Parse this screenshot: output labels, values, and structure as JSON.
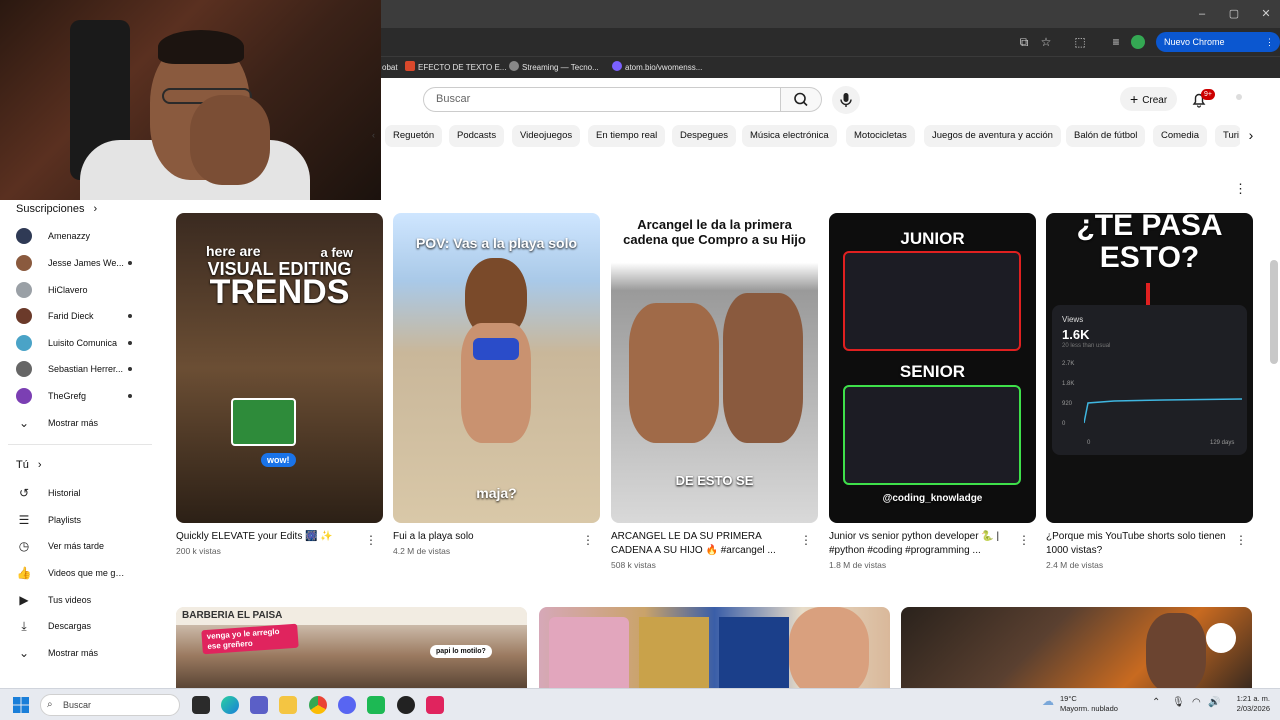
{
  "browser": {
    "window_controls": [
      "–",
      "▢",
      "✕"
    ],
    "update_button": "Nuevo Chrome disponible",
    "bookmarks": [
      {
        "label": "obat"
      },
      {
        "label": "EFECTO DE TEXTO E..."
      },
      {
        "label": "Streaming — Tecno..."
      },
      {
        "label": "atom.bio/vwomenss..."
      }
    ]
  },
  "header": {
    "search_placeholder": "Buscar",
    "create_label": "Crear",
    "notifications_badge": "9+"
  },
  "chips": [
    "Reguetón",
    "Podcasts",
    "Videojuegos",
    "En tiempo real",
    "Despegues",
    "Música electrónica",
    "Motocicletas",
    "Juegos de aventura y acción",
    "Balón de fútbol",
    "Comedia",
    "Turi"
  ],
  "sidebar": {
    "subscriptions_heading": "Suscripciones",
    "subscriptions": [
      {
        "name": "Amenazzy",
        "dot": false,
        "color": "#2f3a55"
      },
      {
        "name": "Jesse James We...",
        "dot": true,
        "color": "#8a5a3e"
      },
      {
        "name": "HiClavero",
        "dot": false,
        "color": "#9aa0a6"
      },
      {
        "name": "Farid Dieck",
        "dot": true,
        "color": "#6b3a2a"
      },
      {
        "name": "Luisito Comunica",
        "dot": true,
        "color": "#4aa3c7"
      },
      {
        "name": "Sebastian Herrer...",
        "dot": true,
        "color": "#666666"
      },
      {
        "name": "TheGrefg",
        "dot": true,
        "color": "#7b3fb3"
      }
    ],
    "show_more": "Mostrar más",
    "you_heading": "Tú",
    "you_items": [
      {
        "label": "Historial",
        "icon": "history-icon",
        "glyph": "↺"
      },
      {
        "label": "Playlists",
        "icon": "playlists-icon",
        "glyph": "☰"
      },
      {
        "label": "Ver más tarde",
        "icon": "watch-later-icon",
        "glyph": "◷"
      },
      {
        "label": "Videos que me gus...",
        "icon": "like-icon",
        "glyph": "👍"
      },
      {
        "label": "Tus videos",
        "icon": "your-videos-icon",
        "glyph": "▶"
      },
      {
        "label": "Descargas",
        "icon": "downloads-icon",
        "glyph": "⤓"
      }
    ],
    "you_show_more": "Mostrar más"
  },
  "shorts": [
    {
      "title": "Quickly ELEVATE your Edits 🎆 ✨",
      "views": "200 k vistas",
      "thumb_text": [
        "here are",
        "a few",
        "VISUAL EDITING",
        "TRENDS",
        "wow!"
      ],
      "bg": "#5a4430"
    },
    {
      "title": "Fui a la playa solo",
      "views": "4.2 M de vistas",
      "thumb_text": [
        "POV: Vas a la playa solo",
        "maja?"
      ],
      "bg": "#c9b79a"
    },
    {
      "title": "ARCANGEL LE DA SU PRIMERA CADENA A SU HIJO 🔥 #arcangel ...",
      "views": "508 k vistas",
      "thumb_text": [
        "Arcangel le da la primera cadena que Compro a su Hijo",
        "DE ESTO SE"
      ],
      "bg": "#8f8f8f"
    },
    {
      "title": "Junior vs senior python developer 🐍 | #python #coding #programming ...",
      "views": "1.8 M de vistas",
      "thumb_text": [
        "JUNIOR",
        "SENIOR",
        "@coding_knowladge"
      ],
      "bg": "#111111"
    },
    {
      "title": "¿Porque mis YouTube shorts solo tienen 1000 vistas?",
      "views": "2.4 M de vistas",
      "thumb_text": [
        "¿TE PASA",
        "ESTO?",
        "Views",
        "1.6K",
        "20 less than usual",
        "2.7K",
        "1.8K",
        "920",
        "0",
        "0",
        "129 days"
      ],
      "bg": "#1a1a1a"
    }
  ],
  "videos_row2": [
    {
      "thumb_text": [
        "BARBERIA EL PAISA",
        "venga yo le arreglo ese greñero",
        "papi lo motilo?"
      ],
      "bg": "#6a5548"
    },
    {
      "thumb_text": [],
      "bg": "#d9c7b0"
    },
    {
      "thumb_text": [],
      "bg": "#3a2a1f"
    }
  ],
  "taskbar": {
    "search_placeholder": "Buscar",
    "weather_temp": "19°C",
    "weather_desc": "Mayorm. nublado",
    "time": "1:21 a. m.",
    "date": "2/03/2026"
  }
}
